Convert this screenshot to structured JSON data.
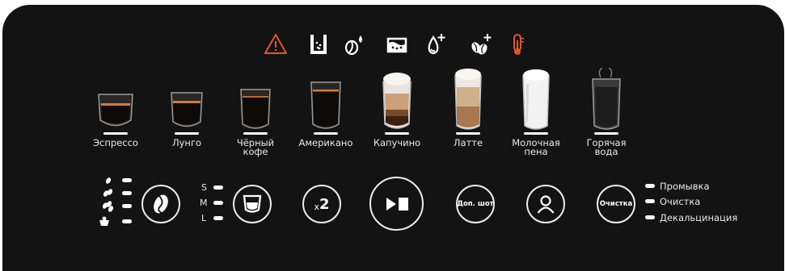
{
  "status_icons": [
    {
      "icon": "warning-icon",
      "color": "#e2562a"
    },
    {
      "icon": "grounds-container-icon",
      "color": "#ffffff"
    },
    {
      "icon": "coffee-water-icon",
      "color": "#ffffff"
    },
    {
      "icon": "drip-tray-icon",
      "color": "#ffffff"
    },
    {
      "icon": "add-water-icon",
      "color": "#ffffff"
    },
    {
      "icon": "add-beans-icon",
      "color": "#ffffff"
    },
    {
      "icon": "temperature-icon",
      "color": "#e2562a"
    }
  ],
  "drinks": [
    {
      "label": "Эспрессо",
      "type": "espresso"
    },
    {
      "label": "Лунго",
      "type": "lungo"
    },
    {
      "label": "Чёрный\nкофе",
      "type": "black"
    },
    {
      "label": "Американо",
      "type": "americano"
    },
    {
      "label": "Капучино",
      "type": "cappuccino"
    },
    {
      "label": "Латте",
      "type": "latte"
    },
    {
      "label": "Молочная\nпена",
      "type": "foam"
    },
    {
      "label": "Горячая\nвода",
      "type": "water"
    }
  ],
  "strength": {
    "levels": 4,
    "button_icon": "coffee-bean-icon"
  },
  "size": {
    "labels": [
      "S",
      "M",
      "L"
    ],
    "button_icon": "cup-icon"
  },
  "double_label": "x2",
  "start_stop_icon": "play-stop-icon",
  "extra_shot_label": "Доп. шот",
  "profile_icon": "user-icon",
  "clean_button_label": "Очистка",
  "clean_options": [
    "Промывка",
    "Очистка",
    "Декальцинация"
  ],
  "colors": {
    "panel": "#141313",
    "warning": "#e2562a",
    "ring": "#ededed",
    "crema": "#d47a36"
  }
}
